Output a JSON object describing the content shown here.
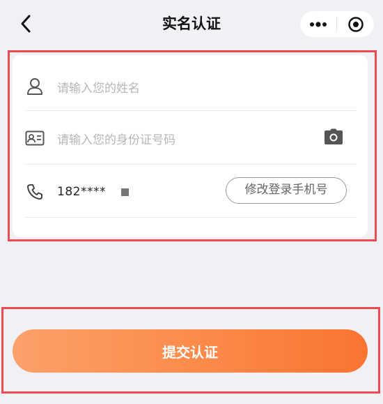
{
  "nav": {
    "title": "实名认证",
    "back_icon": "chevron-left-icon",
    "more_icon": "more-dots-icon",
    "close_icon": "target-close-icon"
  },
  "form": {
    "name_placeholder": "请输入您的姓名",
    "id_placeholder": "请输入您的身份证号码",
    "phone_value": "182****",
    "change_phone_label": "修改登录手机号"
  },
  "submit_label": "提交认证",
  "colors": {
    "accent_start": "#fca06a",
    "accent_end": "#fa7430",
    "highlight": "#ee4a52",
    "background": "#f1f0f5"
  }
}
